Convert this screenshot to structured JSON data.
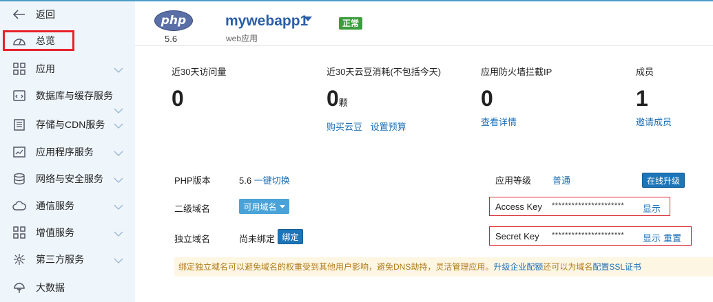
{
  "sidebar": {
    "back_label": "返回",
    "items": [
      {
        "label": "总览",
        "icon": "dashboard-icon"
      },
      {
        "label": "应用",
        "icon": "grid-icon"
      },
      {
        "label": "数据库与缓存服务",
        "icon": "database-code-icon"
      },
      {
        "label": "存储与CDN服务",
        "icon": "notepad-icon"
      },
      {
        "label": "应用程序服务",
        "icon": "chart-window-icon"
      },
      {
        "label": "网络与安全服务",
        "icon": "stack-icon"
      },
      {
        "label": "通信服务",
        "icon": "cloud-icon"
      },
      {
        "label": "增值服务",
        "icon": "grid-icon"
      },
      {
        "label": "第三方服务",
        "icon": "hub-icon"
      },
      {
        "label": "大数据",
        "icon": "tree-icon"
      }
    ]
  },
  "header": {
    "logo_text": "php",
    "php_version": "5.6",
    "app_name": "mywebapp1",
    "app_type": "web应用",
    "status": "正常"
  },
  "stats": [
    {
      "title": "近30天访问量",
      "value": "0",
      "unit": "",
      "links": []
    },
    {
      "title": "近30天云豆消耗(不包括今天)",
      "value": "0",
      "unit": "颗",
      "links": [
        "购买云豆",
        "设置预算"
      ]
    },
    {
      "title": "应用防火墙拦截IP",
      "value": "0",
      "unit": "",
      "links": [
        "查看详情"
      ]
    },
    {
      "title": "成员",
      "value": "1",
      "unit": "",
      "links": [
        "邀请成员"
      ]
    }
  ],
  "settings": {
    "php_version_label": "PHP版本",
    "php_version_value": "5.6",
    "switch_link": "一键切换",
    "subdomain_label": "二级域名",
    "subdomain_button": "可用域名",
    "custom_domain_label": "独立域名",
    "custom_domain_value": "尚未绑定",
    "bind_button": "绑定",
    "level_label": "应用等级",
    "level_value": "普通",
    "upgrade_button": "在线升级",
    "access_key_label": "Access Key",
    "access_key_mask": "**********************",
    "access_key_show": "显示",
    "secret_key_label": "Secret Key",
    "secret_key_mask": "**********************",
    "secret_key_show": "显示",
    "secret_key_reset": "重置"
  },
  "notice": {
    "text": "绑定独立域名可以避免域名的权重受到其他用户影响，避免DNS劫持，灵活管理应用。",
    "link1": "升级企业配额",
    "text2": "还可以为域名",
    "link2": "配置SSL证书"
  },
  "colors": {
    "accent": "#1b6fb8",
    "status_green": "#3c9d3c",
    "highlight_red": "#d9232c",
    "sidebar_bg": "#eef5fb"
  }
}
